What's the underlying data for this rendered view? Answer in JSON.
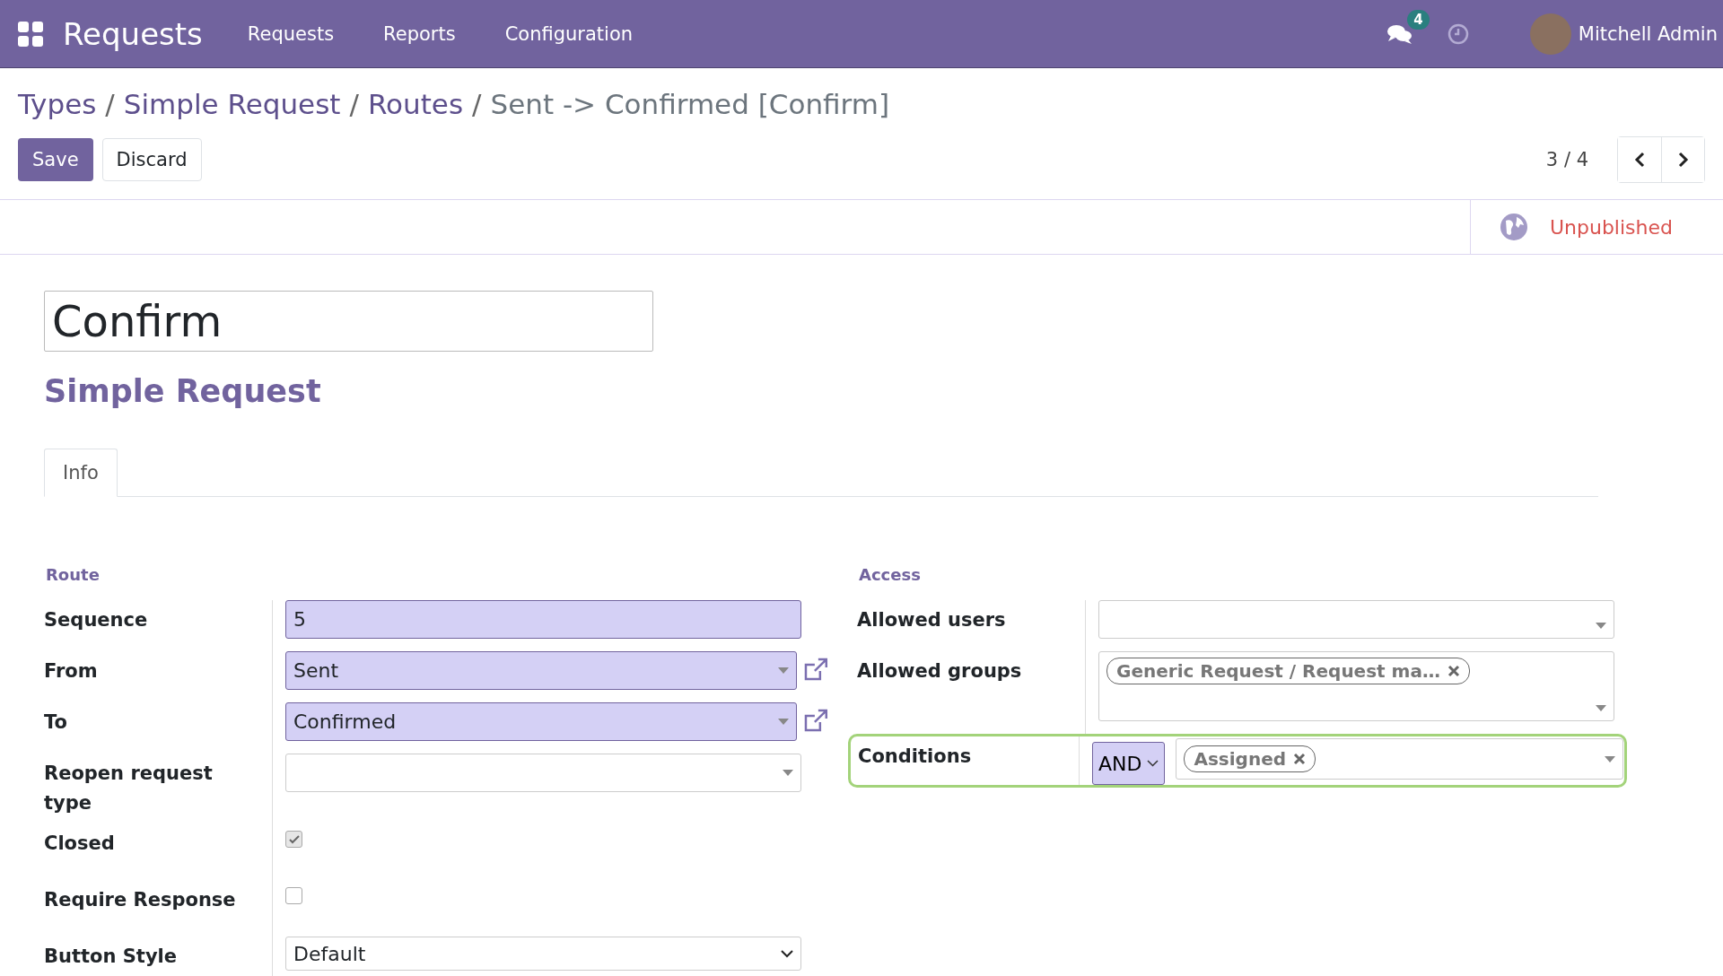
{
  "navbar": {
    "app_title": "Requests",
    "menu": [
      "Requests",
      "Reports",
      "Configuration"
    ],
    "messages_badge": "4",
    "user_name": "Mitchell Admin"
  },
  "breadcrumb": {
    "links": [
      "Types",
      "Simple Request",
      "Routes"
    ],
    "separator": "/",
    "current": "Sent -> Confirmed [Confirm]"
  },
  "buttons": {
    "save": "Save",
    "discard": "Discard"
  },
  "pager": {
    "value": "3 / 4"
  },
  "status": {
    "label": "Unpublished"
  },
  "record": {
    "name": "Confirm",
    "subtitle": "Simple Request"
  },
  "tabs": [
    {
      "label": "Info",
      "selected": true
    }
  ],
  "route": {
    "title": "Route",
    "fields": [
      {
        "kind": "text",
        "label": "Sequence",
        "value": "5",
        "required": true
      },
      {
        "kind": "many2one",
        "label": "From",
        "value": "Sent",
        "required": true
      },
      {
        "kind": "many2one",
        "label": "To",
        "value": "Confirmed",
        "required": true
      },
      {
        "kind": "many2one",
        "label": "Reopen request type",
        "required": false
      },
      {
        "kind": "checkbox",
        "label": "Closed",
        "checked": true,
        "disabled": true
      },
      {
        "kind": "checkbox",
        "label": "Require Response",
        "checked": false,
        "disabled": false
      },
      {
        "kind": "select",
        "label": "Button Style",
        "value": "Default"
      }
    ]
  },
  "access": {
    "title": "Access",
    "fields": [
      {
        "kind": "many2one",
        "label": "Allowed users"
      },
      {
        "kind": "tags",
        "label": "Allowed groups",
        "tags": [
          "Generic Request / Request ma…"
        ]
      },
      {
        "kind": "conditions",
        "label": "Conditions",
        "operator": "AND",
        "tags": [
          "Assigned"
        ],
        "highlighted": true
      }
    ]
  }
}
